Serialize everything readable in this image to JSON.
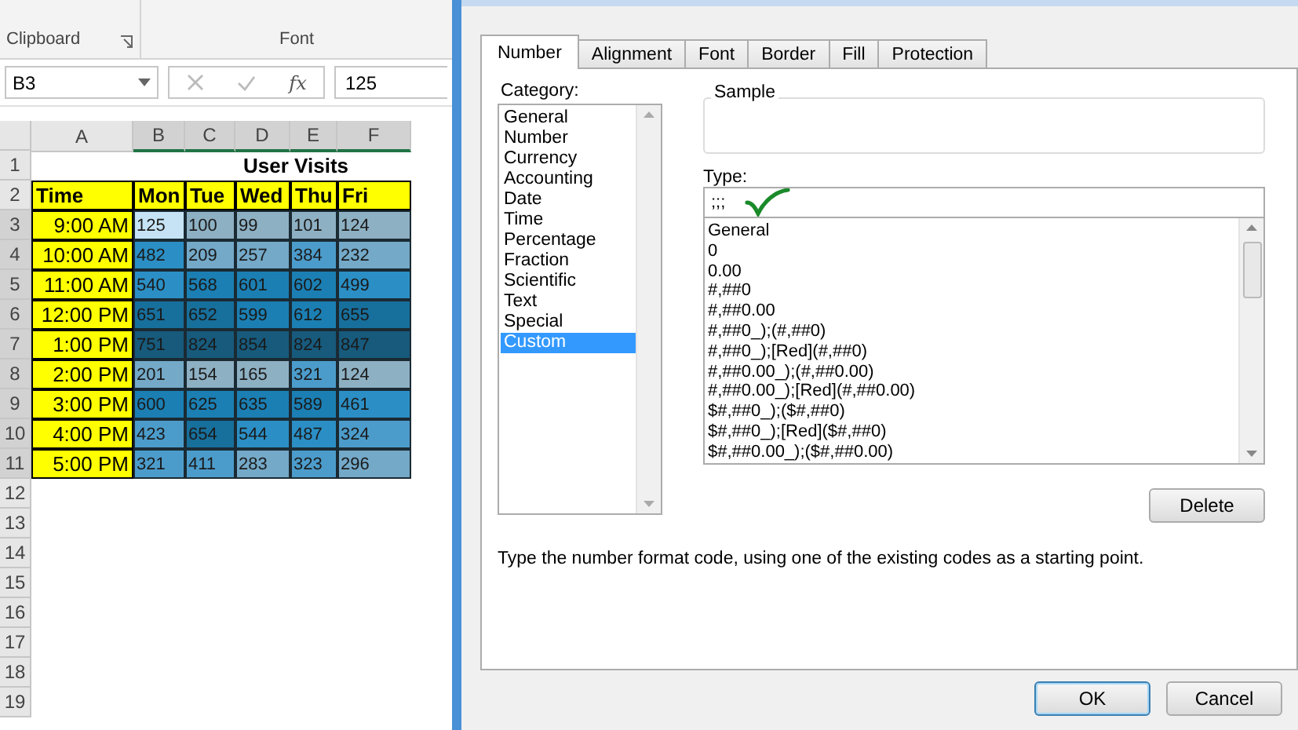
{
  "ribbon": {
    "groups": [
      {
        "label": "Clipboard"
      },
      {
        "label": "Font"
      }
    ]
  },
  "formula_bar": {
    "name_box": "B3",
    "function_symbol": "fx",
    "value": "125"
  },
  "sheet": {
    "columns": [
      "A",
      "B",
      "C",
      "D",
      "E",
      "F"
    ],
    "row_numbers": [
      "1",
      "2",
      "3",
      "4",
      "5",
      "6",
      "7",
      "8",
      "9",
      "10",
      "11",
      "12",
      "13",
      "14",
      "15",
      "16",
      "17",
      "18",
      "19"
    ],
    "title": "User Visits",
    "header": [
      "Time",
      "Mon",
      "Tue",
      "Wed",
      "Thu",
      "Fri"
    ],
    "rows": [
      {
        "cells": [
          {
            "value": "9:00 AM",
            "kind": "time"
          },
          {
            "value": "125",
            "color": "#c5e3f5"
          },
          {
            "value": "100",
            "color": "#8eb0c3"
          },
          {
            "value": "99",
            "color": "#8eb0c3"
          },
          {
            "value": "101",
            "color": "#8eb0c3"
          },
          {
            "value": "124",
            "color": "#8eb0c3"
          }
        ]
      },
      {
        "cells": [
          {
            "value": "10:00 AM",
            "kind": "time"
          },
          {
            "value": "482",
            "color": "#2b8fc5"
          },
          {
            "value": "209",
            "color": "#74a9c8"
          },
          {
            "value": "257",
            "color": "#74a9c8"
          },
          {
            "value": "384",
            "color": "#4c9ccb"
          },
          {
            "value": "232",
            "color": "#74a9c8"
          }
        ]
      },
      {
        "cells": [
          {
            "value": "11:00 AM",
            "kind": "time"
          },
          {
            "value": "540",
            "color": "#2b8fc5"
          },
          {
            "value": "568",
            "color": "#1b7fb3"
          },
          {
            "value": "601",
            "color": "#1b7fb3"
          },
          {
            "value": "602",
            "color": "#1b7fb3"
          },
          {
            "value": "499",
            "color": "#2b8fc5"
          }
        ]
      },
      {
        "cells": [
          {
            "value": "12:00 PM",
            "kind": "time"
          },
          {
            "value": "651",
            "color": "#176f9c"
          },
          {
            "value": "652",
            "color": "#176f9c"
          },
          {
            "value": "599",
            "color": "#1b7fb3"
          },
          {
            "value": "612",
            "color": "#1b7fb3"
          },
          {
            "value": "655",
            "color": "#176f9c"
          }
        ]
      },
      {
        "cells": [
          {
            "value": "1:00 PM",
            "kind": "time"
          },
          {
            "value": "751",
            "color": "#175a7c"
          },
          {
            "value": "824",
            "color": "#175a7c"
          },
          {
            "value": "854",
            "color": "#175a7c"
          },
          {
            "value": "824",
            "color": "#175a7c"
          },
          {
            "value": "847",
            "color": "#175a7c"
          }
        ]
      },
      {
        "cells": [
          {
            "value": "2:00 PM",
            "kind": "time"
          },
          {
            "value": "201",
            "color": "#74a9c8"
          },
          {
            "value": "154",
            "color": "#8eb0c3"
          },
          {
            "value": "165",
            "color": "#8eb0c3"
          },
          {
            "value": "321",
            "color": "#4c9ccb"
          },
          {
            "value": "124",
            "color": "#8eb0c3"
          }
        ]
      },
      {
        "cells": [
          {
            "value": "3:00 PM",
            "kind": "time"
          },
          {
            "value": "600",
            "color": "#1b7fb3"
          },
          {
            "value": "625",
            "color": "#1b7fb3"
          },
          {
            "value": "635",
            "color": "#1b7fb3"
          },
          {
            "value": "589",
            "color": "#1b7fb3"
          },
          {
            "value": "461",
            "color": "#2b8fc5"
          }
        ]
      },
      {
        "cells": [
          {
            "value": "4:00 PM",
            "kind": "time"
          },
          {
            "value": "423",
            "color": "#4c9ccb"
          },
          {
            "value": "654",
            "color": "#176f9c"
          },
          {
            "value": "544",
            "color": "#2b8fc5"
          },
          {
            "value": "487",
            "color": "#2b8fc5"
          },
          {
            "value": "324",
            "color": "#4c9ccb"
          }
        ]
      },
      {
        "cells": [
          {
            "value": "5:00 PM",
            "kind": "time"
          },
          {
            "value": "321",
            "color": "#4c9ccb"
          },
          {
            "value": "411",
            "color": "#4c9ccb"
          },
          {
            "value": "283",
            "color": "#74a9c8"
          },
          {
            "value": "323",
            "color": "#4c9ccb"
          },
          {
            "value": "296",
            "color": "#74a9c8"
          }
        ]
      }
    ]
  },
  "dialog": {
    "tabs": [
      {
        "label": "Number",
        "selected": true
      },
      {
        "label": "Alignment",
        "selected": false
      },
      {
        "label": "Font",
        "selected": false
      },
      {
        "label": "Border",
        "selected": false
      },
      {
        "label": "Fill",
        "selected": false
      },
      {
        "label": "Protection",
        "selected": false
      }
    ],
    "category_label": "Category:",
    "categories": [
      {
        "label": "General",
        "selected": false
      },
      {
        "label": "Number",
        "selected": false
      },
      {
        "label": "Currency",
        "selected": false
      },
      {
        "label": "Accounting",
        "selected": false
      },
      {
        "label": "Date",
        "selected": false
      },
      {
        "label": "Time",
        "selected": false
      },
      {
        "label": "Percentage",
        "selected": false
      },
      {
        "label": "Fraction",
        "selected": false
      },
      {
        "label": "Scientific",
        "selected": false
      },
      {
        "label": "Text",
        "selected": false
      },
      {
        "label": "Special",
        "selected": false
      },
      {
        "label": "Custom",
        "selected": true
      }
    ],
    "sample_label": "Sample",
    "type_label": "Type:",
    "type_value": ";;;",
    "formats": [
      "General",
      "0",
      "0.00",
      "#,##0",
      "#,##0.00",
      "#,##0_);(#,##0)",
      "#,##0_);[Red](#,##0)",
      "#,##0.00_);(#,##0.00)",
      "#,##0.00_);[Red](#,##0.00)",
      "$#,##0_);($#,##0)",
      "$#,##0_);[Red]($#,##0)",
      "$#,##0.00_);($#,##0.00)"
    ],
    "delete_button": "Delete",
    "description": "Type the number format code, using one of the existing codes as a starting point.",
    "buttons": [
      {
        "label": "OK",
        "kind": "default"
      },
      {
        "label": "Cancel",
        "kind": "normal"
      }
    ]
  }
}
